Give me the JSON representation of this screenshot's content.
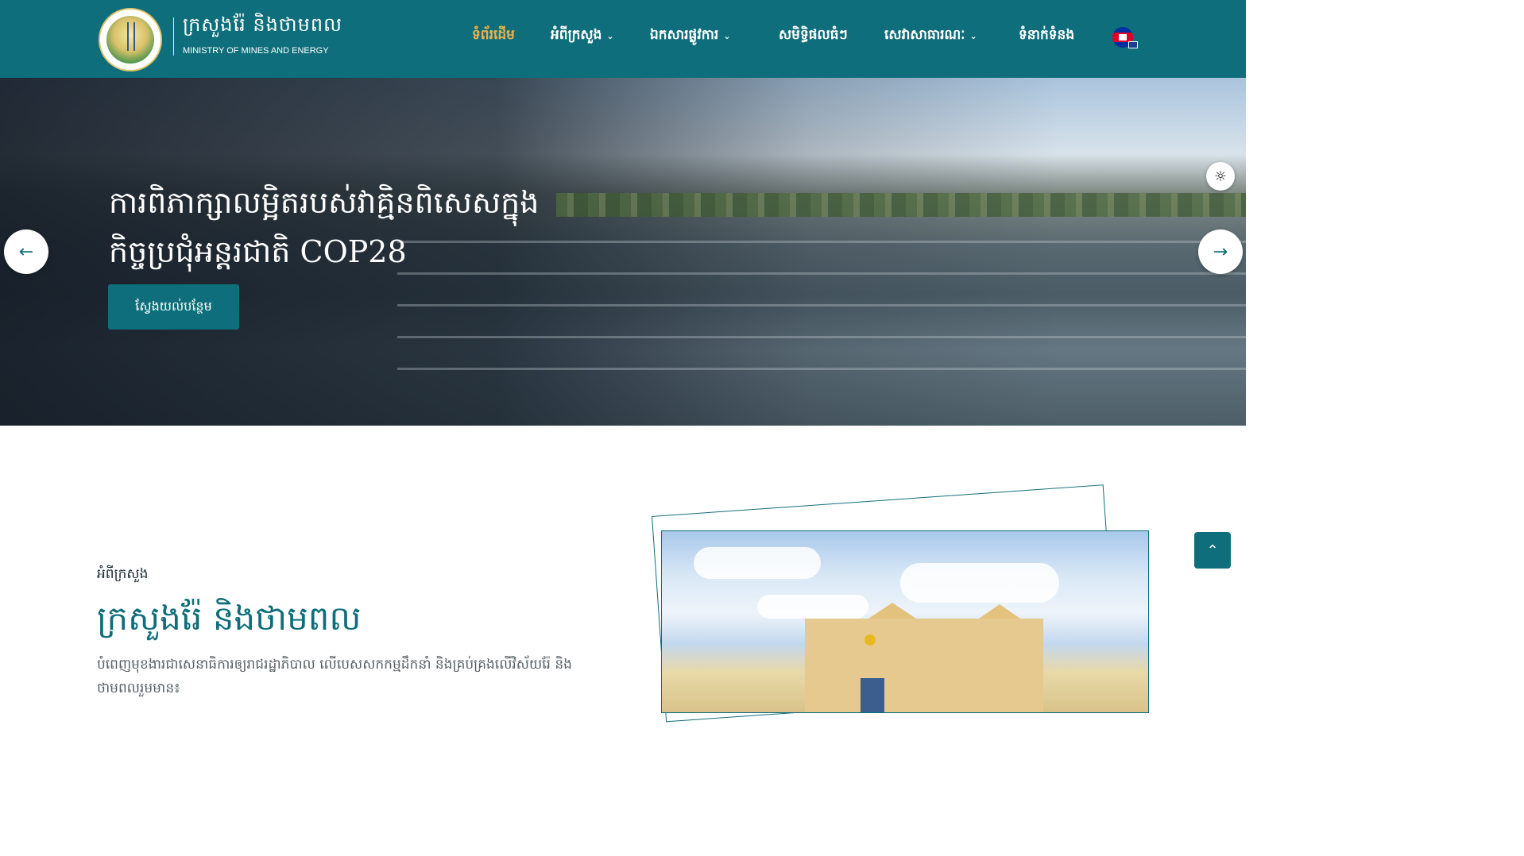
{
  "header": {
    "brand_kh": "ក្រសួងរ៉ែ និងថាមពល",
    "brand_en": "MINISTRY OF MINES AND ENERGY",
    "nav": [
      {
        "label": "ទំព័រដើម",
        "active": true
      },
      {
        "label": "អំពីក្រសួង",
        "dropdown": true
      },
      {
        "label": "ឯកសារផ្លូវការ",
        "dropdown": true
      },
      {
        "label": "សមិទ្ធិផលធំៗ",
        "dropdown": false
      },
      {
        "label": "សេវាសាធារណៈ",
        "dropdown": true
      },
      {
        "label": "ទំនាក់ទំនង",
        "dropdown": false
      }
    ],
    "language": "Khmer / English"
  },
  "hero": {
    "title_line1": "ការពិភាក្សាលម្អិតរបស់វាគ្មិនពិសេសក្នុង",
    "title_line2": "កិច្ចប្រជុំអន្តរជាតិ COP28",
    "button_label": "ស្វែងយល់បន្ថែម",
    "prev_icon": "←",
    "next_icon": "→",
    "theme_icon": "☼"
  },
  "about": {
    "eyebrow": "អំពីក្រសួង",
    "title": "ក្រសួងរ៉ែ និងថាមពល",
    "description": "បំពេញមុខងារជាសេនាធិការឲ្យរាជរដ្ឋាភិបាល លើបេសសកកម្មដឹកនាំ និងគ្រប់គ្រងលើវិស័យរ៉ែ និងថាមពលរួមមាន៖"
  },
  "scroll_top_icon": "⌃",
  "colors": {
    "primary": "#0f6e7b",
    "active_nav": "#f0b24a"
  }
}
